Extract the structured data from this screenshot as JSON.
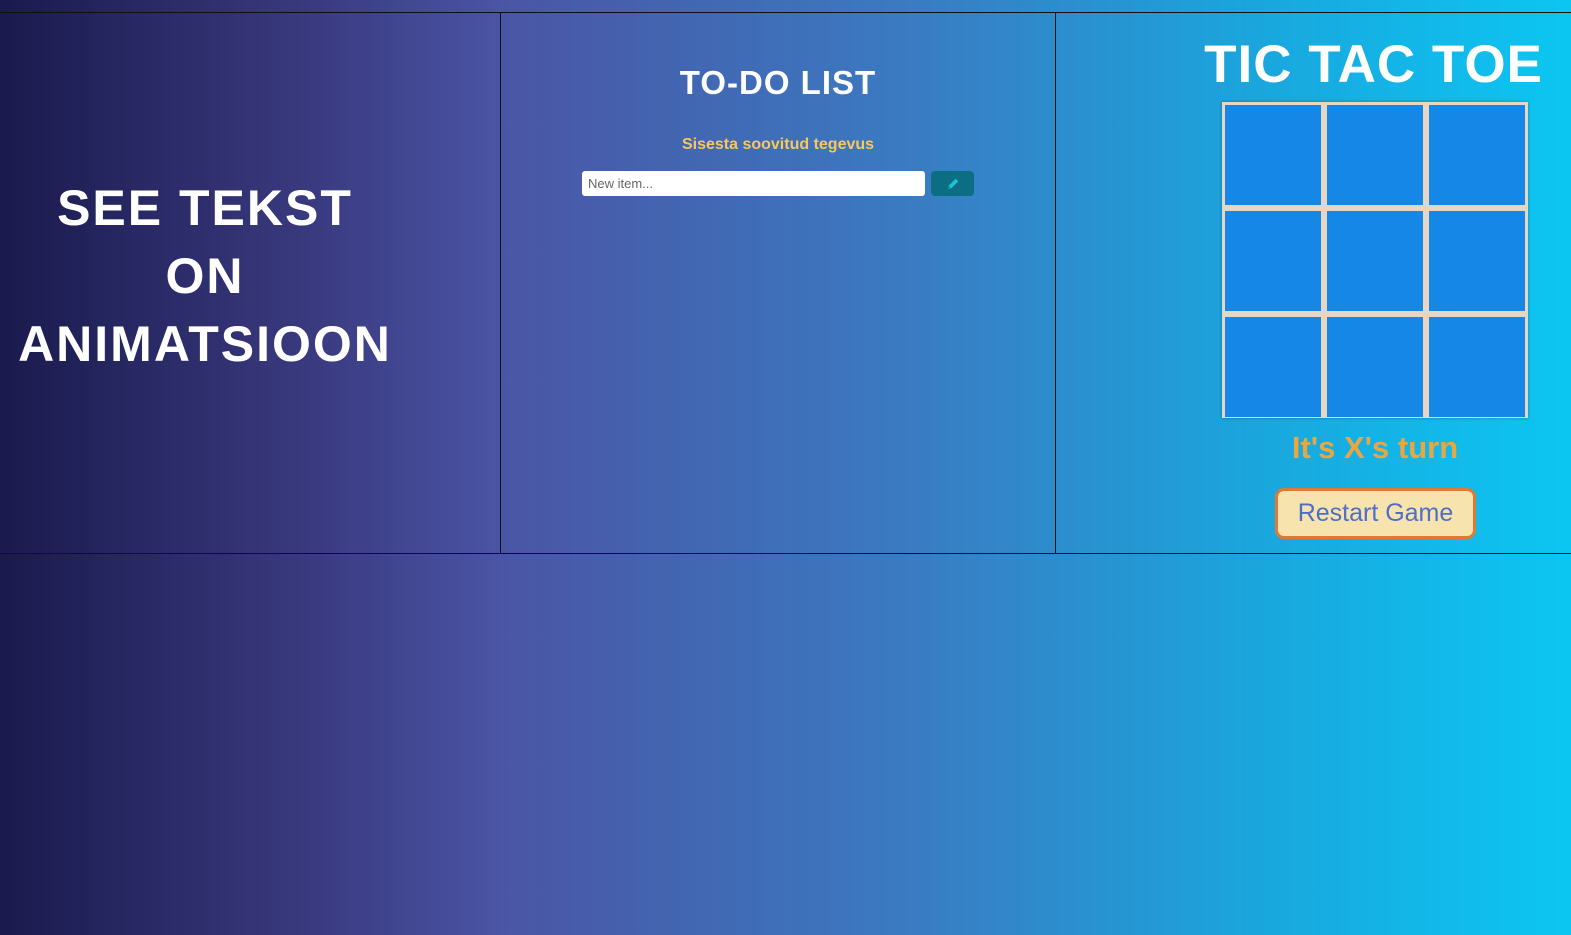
{
  "animation": {
    "line1": "SEE TEKST",
    "line2": "ON",
    "line3": "ANIMATSIOON"
  },
  "todo": {
    "title": "TO-DO LIST",
    "subtitle": "Sisesta soovitud tegevus",
    "input_value": "",
    "input_placeholder": "New item...",
    "add_icon": "pencil-icon"
  },
  "tictactoe": {
    "title": "TIC TAC TOE",
    "cells": [
      "",
      "",
      "",
      "",
      "",
      "",
      "",
      "",
      ""
    ],
    "status": "It's X's turn",
    "restart_label": "Restart Game"
  },
  "colors": {
    "cell": "#1587e6",
    "board_lines": "#e8d6c4",
    "todo_subtitle": "#f7c95a",
    "status_text": "#e8a743",
    "restart_bg": "#f7e3ad",
    "restart_border": "#e07a33",
    "restart_text": "#4f6ec7",
    "add_button": "#0b6e82"
  }
}
